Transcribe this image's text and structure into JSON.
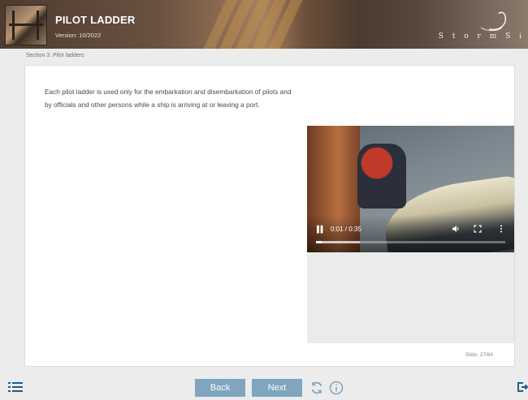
{
  "header": {
    "title": "PILOT LADDER",
    "version": "Version: 10/2022",
    "brand_text": "S t o r m   S i"
  },
  "breadcrumb": "Section 3. Pilot ladders",
  "content": {
    "paragraph": "Each pilot ladder is used only for the embarkation and disembarkation of pilots and by officials and other persons while a ship is arriving at or leaving a port."
  },
  "video": {
    "time": "0:01 / 0:35",
    "progress_fraction": 0.03,
    "buffered_fraction": 0.23,
    "icons": [
      "pause-icon",
      "volume-icon",
      "fullscreen-icon",
      "more-options-icon"
    ]
  },
  "slide_counter": "Slide: 27/64",
  "footer": {
    "back_label": "Back",
    "next_label": "Next",
    "icons": [
      "menu-icon",
      "replay-icon",
      "info-icon",
      "exit-icon"
    ]
  },
  "colors": {
    "nav_button": "#7fa5bf",
    "icon_accent": "#1e5f85"
  }
}
